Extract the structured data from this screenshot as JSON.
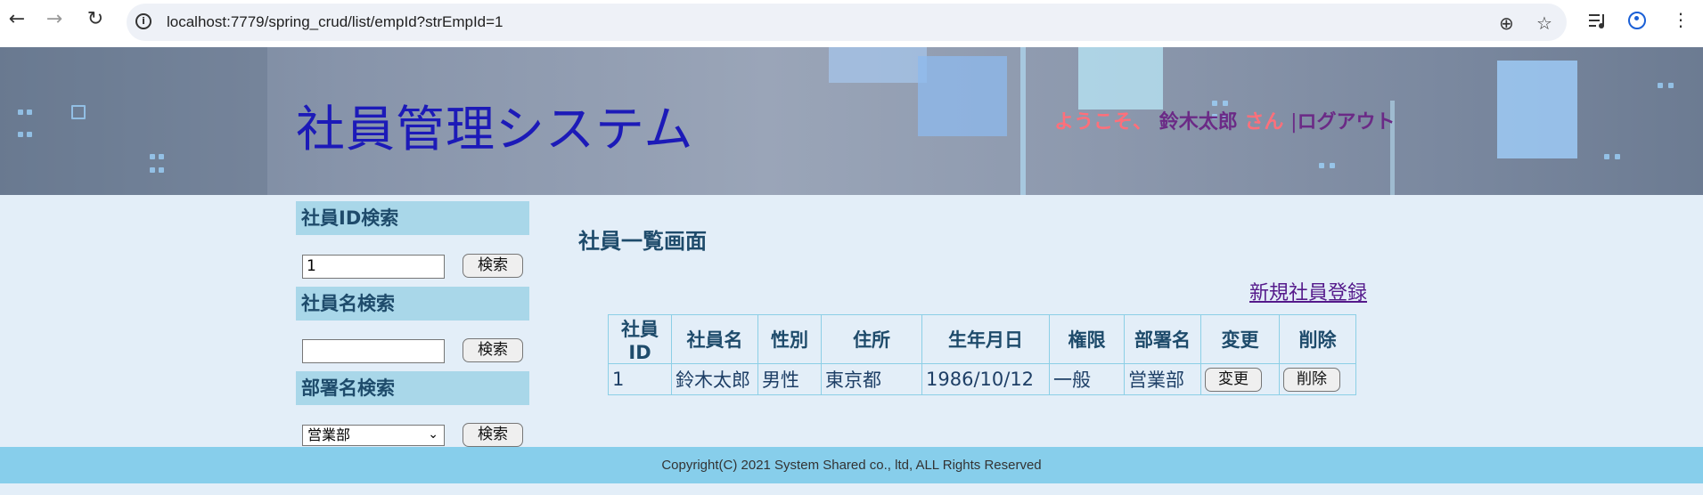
{
  "browser": {
    "url": "localhost:7779/spring_crud/list/empId?strEmpId=1",
    "back": "←",
    "forward": "→",
    "reload": "↻",
    "zoom_icon": "⊕",
    "star_icon": "☆",
    "menu_icon": "⋮"
  },
  "header": {
    "site_title": "社員管理システム",
    "welcome_prefix": "ようこそ、",
    "user_name": "鈴木太郎",
    "suffix": "さん",
    "separator": "|",
    "logout": "ログアウト"
  },
  "sidebar": {
    "id_search": {
      "title": "社員ID検索",
      "value": "1",
      "button": "検索"
    },
    "name_search": {
      "title": "社員名検索",
      "value": "",
      "button": "検索"
    },
    "dept_search": {
      "title": "部署名検索",
      "selected": "営業部",
      "button": "検索"
    }
  },
  "main": {
    "title": "社員一覧画面",
    "new_link": "新規社員登録",
    "columns": [
      "社員ID",
      "社員名",
      "性別",
      "住所",
      "生年月日",
      "権限",
      "部署名",
      "変更",
      "削除"
    ],
    "rows": [
      {
        "id": "1",
        "name": "鈴木太郎",
        "gender": "男性",
        "address": "東京都",
        "birth": "1986/10/12",
        "role": "一般",
        "dept": "営業部",
        "edit": "変更",
        "delete": "削除"
      }
    ]
  },
  "footer": {
    "copyright": "Copyright(C) 2021 System Shared co., ltd, ALL Rights Reserved"
  }
}
